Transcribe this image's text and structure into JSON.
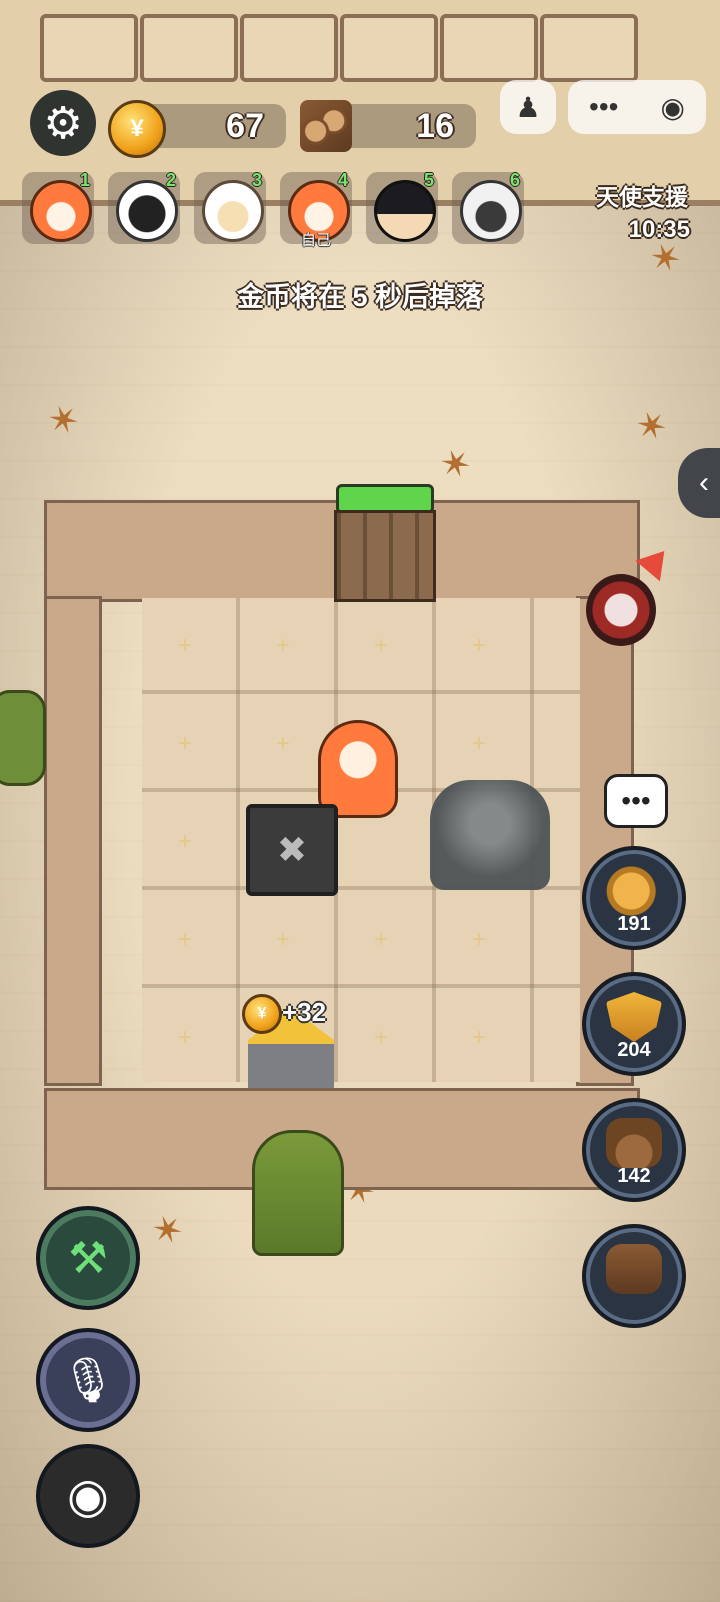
{
  "hud": {
    "gold": "67",
    "wood": "16",
    "support_label": "天使支援",
    "timer": "10:35",
    "coin_glyph": "¥"
  },
  "players": [
    {
      "num": "1",
      "tag": ""
    },
    {
      "num": "2",
      "tag": ""
    },
    {
      "num": "3",
      "tag": ""
    },
    {
      "num": "4",
      "tag": "自己"
    },
    {
      "num": "5",
      "tag": ""
    },
    {
      "num": "6",
      "tag": ""
    }
  ],
  "notice": "金币将在 5 秒后掉落",
  "map": {
    "gain": "+32"
  },
  "right_buttons": [
    {
      "name": "pig-bank-button",
      "count": "191"
    },
    {
      "name": "shield-button",
      "count": "204"
    },
    {
      "name": "poop-button",
      "count": "142"
    },
    {
      "name": "boots-button",
      "count": ""
    }
  ],
  "icons": {
    "settings": "settings-icon",
    "collapse": "chevron-left-icon",
    "chat": "chat-bubble-icon",
    "tools": "tools-icon",
    "mic": "microphone-icon",
    "eye": "eye-icon"
  }
}
